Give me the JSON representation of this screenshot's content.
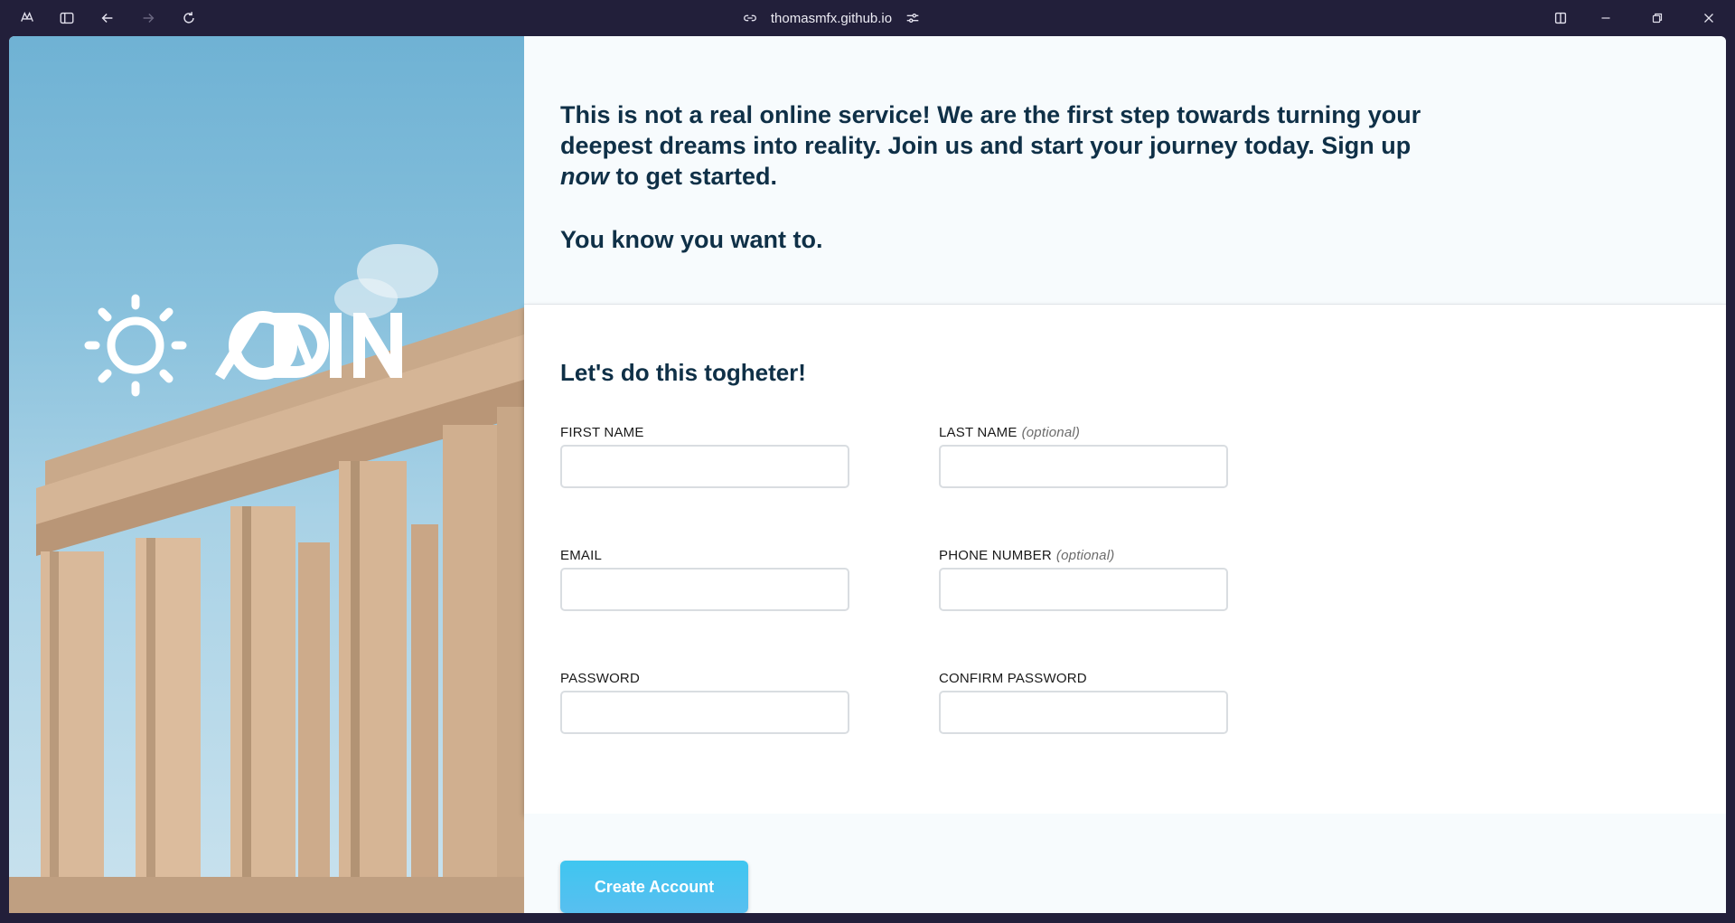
{
  "browser": {
    "url": "thomasmfx.github.io"
  },
  "hero": {
    "logo_text": "ODIN"
  },
  "intro": {
    "line_before_emphasis": "This is not a real online service! We are the first step towards turning your deepest dreams into reality. Join us and start your journey today. Sign up",
    "emphasis": "now",
    "line_after_emphasis": "to get started.",
    "tagline": "You know you want to."
  },
  "form": {
    "title": "Let's do this togheter!",
    "optional_tag": "(optional)",
    "fields": {
      "first_name": "FIRST NAME",
      "last_name": "LAST NAME",
      "email": "EMAIL",
      "phone": "PHONE NUMBER",
      "password": "PASSWORD",
      "confirm_password": "CONFIRM PASSWORD"
    }
  },
  "footer": {
    "button_label": "Create Account"
  }
}
